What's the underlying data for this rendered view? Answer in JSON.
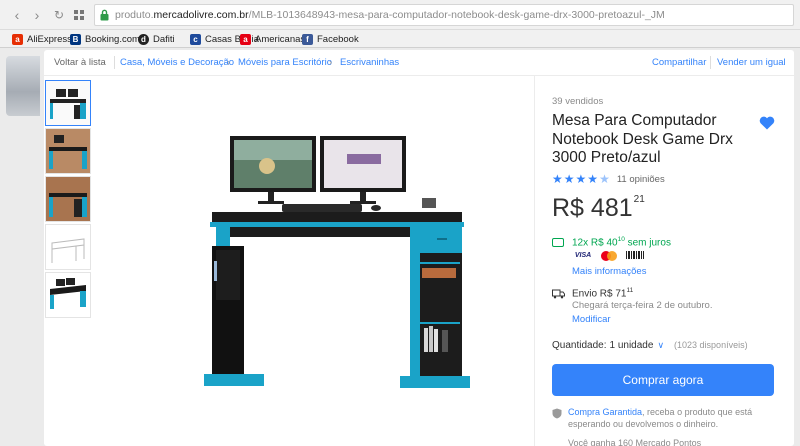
{
  "browser": {
    "url_prefix": "produto.",
    "url_domain": "mercadolivre.com.br",
    "url_path": "/MLB-1013648943-mesa-para-computador-notebook-desk-game-drx-3000-pretoazul-_JM",
    "bookmarks": [
      {
        "label": "AliExpress",
        "color": "#e62e04",
        "icon": "aliexpress-icon"
      },
      {
        "label": "Booking.com",
        "color": "#003580",
        "icon": "booking-icon"
      },
      {
        "label": "Dafiti",
        "color": "#222222",
        "icon": "dafiti-icon"
      },
      {
        "label": "Casas Bahia",
        "color": "#1f4b9c",
        "icon": "casas-bahia-icon"
      },
      {
        "label": "Americanas",
        "color": "#e60014",
        "icon": "americanas-icon"
      },
      {
        "label": "Facebook",
        "color": "#3b5998",
        "icon": "facebook-icon"
      }
    ]
  },
  "breadcrumb": {
    "back": "Voltar à lista",
    "items": [
      "Casa, Móveis e Decoração",
      "Móveis para Escritório",
      "Escrivaninhas"
    ],
    "share": "Compartilhar",
    "sell": "Vender um igual"
  },
  "product": {
    "sold": "39 vendidos",
    "title": "Mesa Para Computador Notebook Desk Game Drx 3000 Preto/azul",
    "rating": 4.5,
    "reviews": "11 opiniões",
    "price_currency": "R$",
    "price_int": "481",
    "price_cents": "21",
    "installments_prefix": "12x R$ 40",
    "installments_cents": "10",
    "installments_suffix": " sem juros",
    "payment_methods": [
      "VISA",
      "Mastercard",
      "Boleto"
    ],
    "more_info": "Mais informações",
    "shipping_prefix": "Envio R$ 71",
    "shipping_cents": "11",
    "arrival": "Chegará terça-feira 2 de outubro.",
    "modify": "Modificar",
    "quantity_label": "Quantidade:",
    "quantity_value": "1 unidade",
    "available": "(1023 disponíveis)",
    "buy_button": "Comprar agora",
    "guarantee_link": "Compra Garantida",
    "guarantee_text": ", receba o produto que está esperando ou devolvemos o dinheiro.",
    "points": "Você ganha 160 Mercado Pontos"
  },
  "colors": {
    "accent": "#3483fa",
    "green": "#00a650",
    "desk_blue": "#1aa3c8"
  }
}
